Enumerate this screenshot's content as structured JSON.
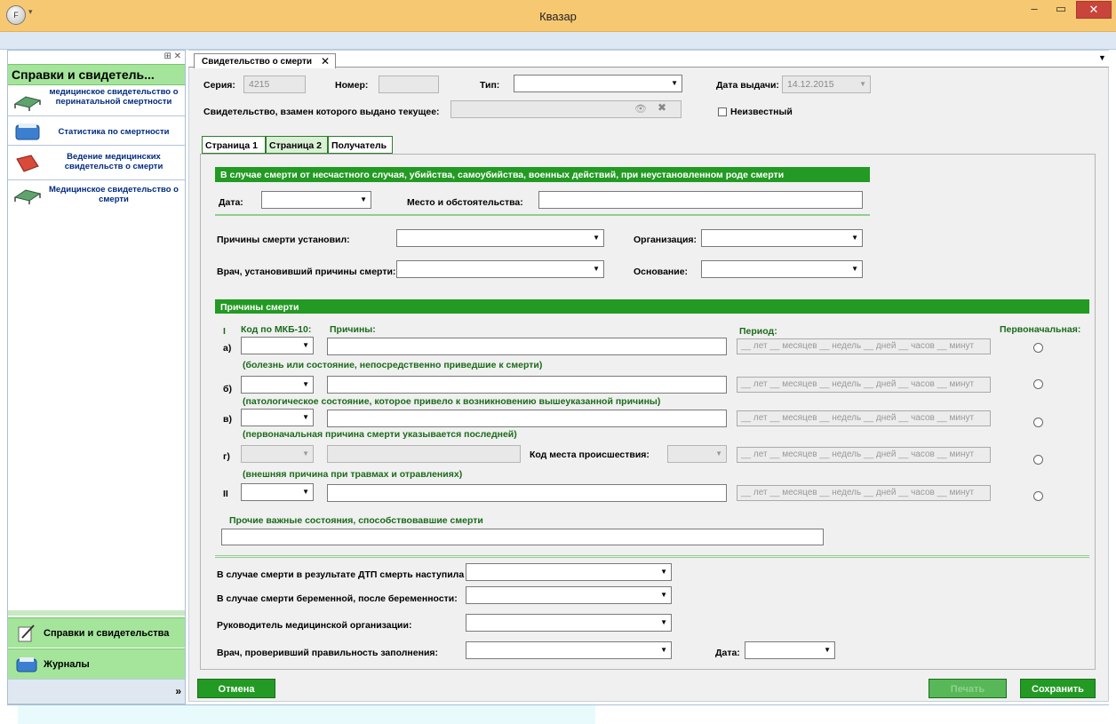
{
  "window": {
    "title": "Квазар",
    "app_button": "F"
  },
  "left_panel": {
    "header": "Справки и свидетель...",
    "items": [
      {
        "label": "медицинское свидетельство о перинатальной смертности",
        "icon": "bed-icon"
      },
      {
        "label": "Статистика по смертности",
        "icon": "stats-icon"
      },
      {
        "label": "Ведение медицинских свидетельств о смерти",
        "icon": "book-icon"
      },
      {
        "label": "Медицинское свидетельство о смерти",
        "icon": "bed-icon"
      }
    ],
    "bottom_buttons": [
      {
        "label": "Справки и свидетельства"
      },
      {
        "label": "Журналы"
      }
    ],
    "footer_chevron": "»"
  },
  "doc_tab": {
    "label": "Свидетельство о смерти",
    "close": "✕"
  },
  "header": {
    "series_label": "Серия:",
    "series_value": "4215",
    "number_label": "Номер:",
    "number_value": "",
    "type_label": "Тип:",
    "issue_date_label": "Дата выдачи:",
    "issue_date_value": "14.12.2015",
    "replacement_label": "Свидетельство, взамен которого выдано текущее:",
    "unknown_label": "Неизвестный"
  },
  "page_tabs": [
    "Страница 1",
    "Страница 2",
    "Получатель"
  ],
  "accident_section": {
    "title": "В случае смерти от несчастного случая, убийства, самоубийства, военных действий, при неустановленном роде смерти",
    "date_label": "Дата:",
    "place_label": "Место и обстоятельства:"
  },
  "causes_meta": {
    "established_by_label": "Причины смерти установил:",
    "organization_label": "Организация:",
    "doctor_label": "Врач, установивший причины смерти:",
    "basis_label": "Основание:"
  },
  "causes": {
    "title": "Причины смерти",
    "roman_one": "I",
    "code_header": "Код по МКБ-10:",
    "cause_header": "Причины:",
    "period_header": "Период:",
    "primary_header": "Первоначальная:",
    "period_placeholder": "__ лет __ месяцев __ недель __ дней __ часов __ минут",
    "rows": [
      {
        "letter": "а)",
        "note": "(болезнь или состояние, непосредственно приведшие к смерти)"
      },
      {
        "letter": "б)",
        "note": "(патологическое состояние, которое привело к возникновению вышеуказанной причины)"
      },
      {
        "letter": "в)",
        "note": "(первоначальная причина смерти указывается последней)"
      },
      {
        "letter": "г)",
        "note": "(внешняя причина при травмах и отравлениях)",
        "place_code_label": "Код места происшествия:"
      },
      {
        "letter": "II",
        "note": ""
      }
    ],
    "other_label": "Прочие важные состояния, способствовавшие смерти"
  },
  "bottom_fields": {
    "dtp_label": "В случае смерти в результате ДТП смерть наступила",
    "pregnant_label": "В случае смерти беременной, после беременности:",
    "head_label": "Руководитель медицинской организации:",
    "checker_label": "Врач, проверивший правильность заполнения:",
    "date_label": "Дата:"
  },
  "buttons": {
    "cancel": "Отмена",
    "print": "Печать",
    "save": "Сохранить"
  },
  "colors": {
    "accent_green": "#239a23",
    "titlebar": "#f7c872",
    "panel_green": "#a4e59b"
  }
}
